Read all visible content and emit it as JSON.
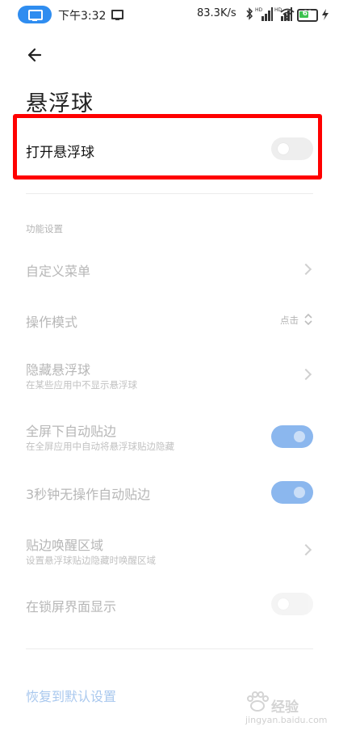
{
  "status_bar": {
    "time": "下午3:32",
    "net_speed": "83.3K/s",
    "battery_level": "61",
    "battery_percent": 0.61,
    "colors": {
      "app_pill": "#2f8df0",
      "battery": "#3cc24f"
    }
  },
  "header": {
    "back_icon": "arrow-left-icon",
    "title": "悬浮球"
  },
  "main_toggle": {
    "label": "打开悬浮球",
    "on": false,
    "highlight_color": "#ff0000"
  },
  "section": {
    "title": "功能设置"
  },
  "settings": {
    "custom_menu": {
      "label": "自定义菜单"
    },
    "mode": {
      "label": "操作模式",
      "value": "点击"
    },
    "hide": {
      "label": "隐藏悬浮球",
      "sub": "在某些应用中不显示悬浮球"
    },
    "fullscreen_edge": {
      "label": "全屏下自动贴边",
      "sub": "在全屏应用中自动将悬浮球贴边隐藏",
      "on": true
    },
    "idle_edge": {
      "label": "3秒钟无操作自动贴边",
      "on": true
    },
    "wake_area": {
      "label": "贴边唤醒区域",
      "sub": "设置悬浮球贴边隐藏时唤醒区域"
    },
    "lockscreen": {
      "label": "在锁屏界面显示",
      "on": false
    }
  },
  "footer": {
    "reset": "恢复到默认设置",
    "watermark_text": "经验",
    "watermark_url": "jingyan.baidu.com"
  },
  "colors": {
    "toggle_on": "#8bb7ee",
    "toggle_off": "#eeeeee",
    "link": "#a9c8ee"
  }
}
